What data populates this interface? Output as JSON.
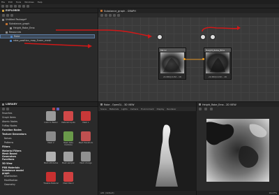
{
  "menubar": [
    "File",
    "Edit",
    "Tools",
    "Windows",
    "Help"
  ],
  "explorer": {
    "title": "EXPLORER",
    "items": [
      {
        "label": "Untitled Package*",
        "depth": 0
      },
      {
        "label": "Substance_graph",
        "depth": 1
      },
      {
        "label": "Height_Robe_Ema",
        "depth": 2
      },
      {
        "label": "Resources",
        "depth": 1
      },
      {
        "label": "Robe",
        "depth": 2,
        "selected": true
      },
      {
        "label": "robe_position_map_Evern_mesh",
        "depth": 2
      }
    ]
  },
  "graph": {
    "title": "Substance_graph - GRAPH",
    "node1": {
      "title": "Mirror",
      "footer": "2K 8Bit|16 Bit - CB"
    },
    "node2": {
      "title": "Height_Robe_Ema",
      "footer": "2K 8Bit|16 Bit - CB"
    }
  },
  "library": {
    "title": "LIBRARY",
    "categories": [
      {
        "label": "Favorites",
        "bold": false
      },
      {
        "label": "Graph Items",
        "bold": false
      },
      {
        "label": "Atomic Nodes",
        "bold": false
      },
      {
        "label": "FxMap Nodes",
        "bold": false
      },
      {
        "label": "Function Nodes",
        "bold": true
      },
      {
        "label": "Texture Generators",
        "bold": true
      },
      {
        "label": "Noises",
        "bold": false
      },
      {
        "label": "Patterns",
        "bold": false
      },
      {
        "label": "Filters",
        "bold": true
      },
      {
        "label": "Material Filters",
        "bold": true
      },
      {
        "label": "Mesh Based Generators",
        "bold": true
      },
      {
        "label": "Functions",
        "bold": true
      },
      {
        "label": "3D View",
        "bold": true
      },
      {
        "label": "PBR Materials",
        "bold": true
      },
      {
        "label": "Substance model graph",
        "bold": true
      },
      {
        "label": "Distribution",
        "bold": false
      },
      {
        "label": "Modification",
        "bold": false
      },
      {
        "label": "Geometry",
        "bold": false
      }
    ],
    "items": [
      {
        "label": "Cubic to Bezier",
        "color": "#9a9a9a"
      },
      {
        "label": "Material Inputs",
        "color": "#d04848"
      },
      {
        "label": "Mesh 1",
        "color": "#c83838"
      },
      {
        "label": "Mesh 2",
        "color": "#8a8a8a"
      },
      {
        "label": "Mesh Data Combine",
        "color": "#6a9a4a"
      },
      {
        "label": "Mesh Transform",
        "color": "#c05050"
      },
      {
        "label": "Mesh Attributes",
        "color": "#b0b0b0"
      },
      {
        "label": "Mesh sampler",
        "color": "#a0a0a0"
      },
      {
        "label": "Mesh change",
        "color": "#909090"
      },
      {
        "label": "Tileable Material",
        "color": "#c83030"
      },
      {
        "label": "Mesh Blend",
        "color": "#d04040"
      },
      {
        "label": "",
        "color": "#2a2a2a"
      }
    ]
  },
  "view3d": {
    "title": "Robe - OpenGL - 3D VIEW",
    "menu": [
      "Scene",
      "Materials",
      "Lights",
      "Camera",
      "Environment",
      "Display",
      "Renderer"
    ],
    "status": "alt1 (default)"
  },
  "view2d": {
    "title": "Height_Robe_Ema - 2D VIEW",
    "status": "14.27%"
  }
}
